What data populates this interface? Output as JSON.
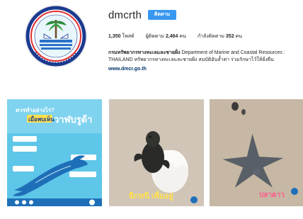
{
  "profile": {
    "username": "dmcrth",
    "follow_label": "ติดตาม",
    "stats": {
      "posts_count": "1,350",
      "posts_label": "โพสต์",
      "followers_label": "ผู้ติดตาม",
      "followers_count": "2,464",
      "followers_unit": "คน",
      "following_label": "กำลังติดตาม",
      "following_count": "352",
      "following_unit": "คน"
    },
    "bio": {
      "name": "กรมทรัพยากรทางทะเลและชายฝั่ง",
      "description_en": " Department of Marine and Coastal Resources : THAILAND",
      "description_th": " ทรัพยากรทางทะเลและชายฝั่ง สมบัติอันล้ำค่า ร่วมรักษาไว้ให้ยั่งยืน",
      "website": "www.dmcr.go.th"
    }
  },
  "posts": [
    {
      "title_line1": "ควรทำอย่างไร?",
      "title_line2": "เมื่อพบเห็น",
      "title_line3": "วาฬบรูด้า",
      "bg_color": "#5ec6e8"
    },
    {
      "caption_line1": "ฉีกหนี เพื่ออยู่",
      "caption_line2": "",
      "bg_color": "#d9cfc2"
    },
    {
      "caption_line1": "ปลาดาว",
      "caption_line2": "",
      "bg_color": "#cdbfad"
    }
  ],
  "colors": {
    "follow_button": "#3897f0",
    "link": "#003569",
    "text": "#262626"
  },
  "icons": {
    "avatar": "dmcr-logo-icon",
    "whale": "whale-icon",
    "turtle": "turtle-icon",
    "starfish": "starfish-icon"
  }
}
